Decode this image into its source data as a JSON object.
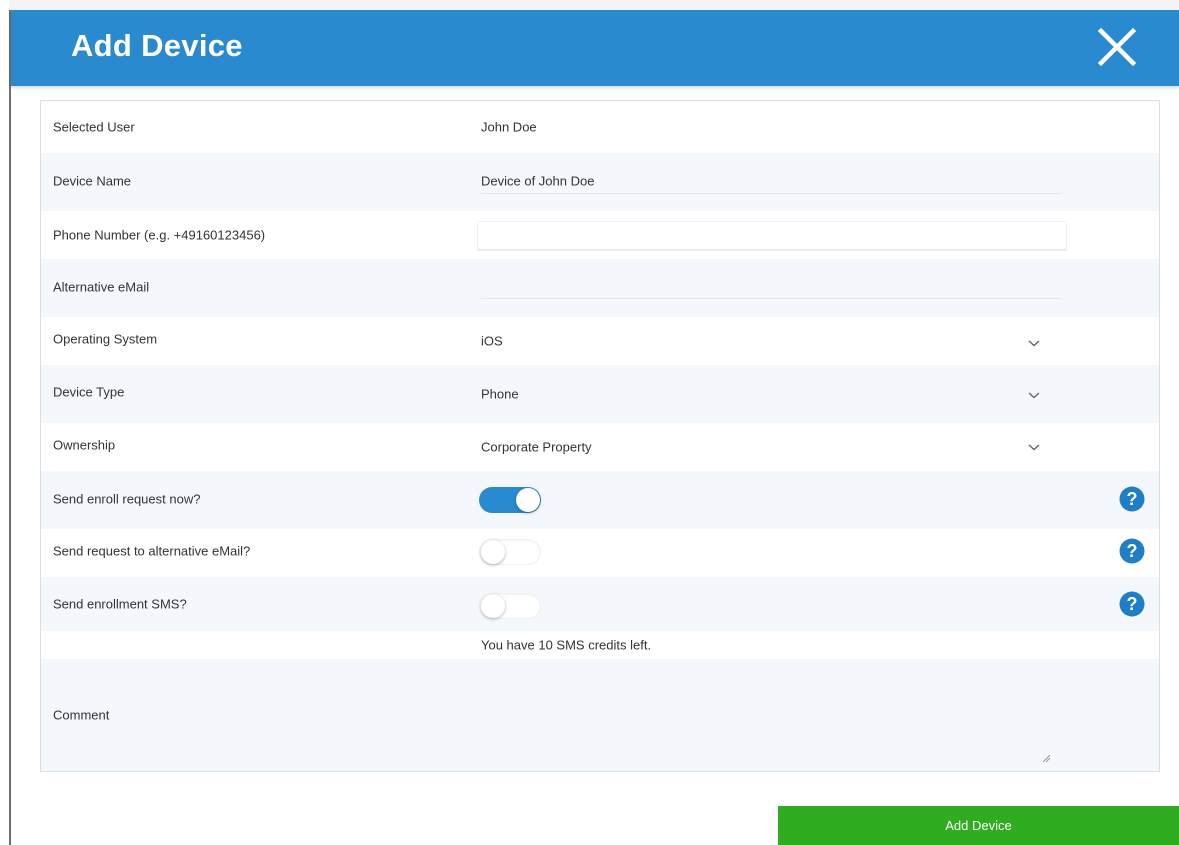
{
  "dialog": {
    "title": "Add Device",
    "close_icon": "close-icon"
  },
  "fields": {
    "selected_user": {
      "label": "Selected User",
      "value": "John Doe"
    },
    "device_name": {
      "label": "Device Name",
      "value": "Device of John Doe"
    },
    "phone_number": {
      "label": "Phone Number (e.g. +49160123456)",
      "value": ""
    },
    "alternative_email": {
      "label": "Alternative eMail",
      "value": ""
    },
    "operating_system": {
      "label": "Operating System",
      "value": "iOS",
      "icon": "chevron-down-icon"
    },
    "device_type": {
      "label": "Device Type",
      "value": "Phone",
      "icon": "chevron-down-icon"
    },
    "ownership": {
      "label": "Ownership",
      "value": "Corporate Property",
      "icon": "chevron-down-icon"
    },
    "send_enroll_request": {
      "label": "Send enroll request now?",
      "on": true,
      "icon": "help-icon"
    },
    "send_alt_email": {
      "label": "Send request to alternative eMail?",
      "on": false,
      "icon": "help-icon"
    },
    "send_sms": {
      "label": "Send enrollment SMS?",
      "on": false,
      "icon": "help-icon"
    },
    "sms_note": "You have 10 SMS credits left.",
    "comment": {
      "label": "Comment",
      "value": ""
    }
  },
  "actions": {
    "submit_label": "Add Device"
  },
  "colors": {
    "header": "#2a8ad0",
    "submit": "#2fac1f",
    "toggle_on": "#2a8ad0",
    "help_icon": "#1f7fc6"
  }
}
